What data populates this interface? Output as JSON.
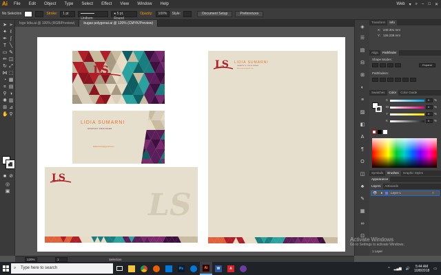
{
  "menubar": {
    "logo": "Ai",
    "items": [
      "File",
      "Edit",
      "Object",
      "Type",
      "Select",
      "Effect",
      "View",
      "Window",
      "Help"
    ],
    "workspace": "Web"
  },
  "control_bar": {
    "selection_label": "No Selection",
    "stroke_label": "Stroke:",
    "stroke_weight": "1 pt",
    "uniform_label": "Uniform",
    "brush_label": "5 pt. Round",
    "opacity_label": "Opacity:",
    "opacity_value": "100%",
    "style_label": "Style:",
    "doc_setup_label": "Document Setup",
    "preferences_label": "Preferences"
  },
  "tabs": [
    {
      "label": "logo lidia.ai @ 100% (RGB/Preview)",
      "active": false
    },
    {
      "label": "bugas polygonai.ai @ 120% (CMYK/Preview)",
      "active": true
    }
  ],
  "business_card": {
    "name": "LIDIA SUMARNI",
    "title": "GRAPHIC DESIGNER",
    "email": "lidiasumarni@gmail.com",
    "logo": "LS"
  },
  "letterhead": {
    "name": "LIDIA SUMARNI",
    "title": "GRAPHIC DESIGNER",
    "email": "lidiasumarni@gmail.com",
    "logo": "LS"
  },
  "envelope": {
    "logo": "LS",
    "watermark_logo": "LS"
  },
  "statusbar": {
    "zoom": "120%",
    "page": "1",
    "tool": "Selection"
  },
  "panels": {
    "transform_tab": "Transform",
    "info_tab": "Info",
    "x_label": "X:",
    "x_value": "240.301 mm",
    "y_label": "Y:",
    "y_value": "126.239 mm",
    "align_tab": "Align",
    "pathfinder_tab": "Pathfinder",
    "shape_modes": "Shape Modes:",
    "expand": "Expand",
    "pathfinders": "Pathfinders:",
    "swatches_tab": "Swatches",
    "color_tab": "Color",
    "color_guide_tab": "Color Guide",
    "channels": [
      {
        "label": "C",
        "value": "0",
        "unit": "%",
        "color": "#00a0e6"
      },
      {
        "label": "M",
        "value": "0",
        "unit": "%",
        "color": "#e6007e"
      },
      {
        "label": "Y",
        "value": "0",
        "unit": "%",
        "color": "#ffe600"
      },
      {
        "label": "K",
        "value": "0",
        "unit": "%",
        "color": "#222222"
      }
    ],
    "symbols_tab": "Symbols",
    "brushes_tab": "Brushes",
    "graphic_styles_tab": "Graphic Styles",
    "appearance_tab": "Appearance",
    "layers_tab": "Layers",
    "artboards_tab": "Artboards",
    "layer_name": "Layer 1",
    "layer_count": "1 Layer"
  },
  "windows_watermark": {
    "line1": "Activate Windows",
    "line2": "Go to Settings to activate Windows."
  },
  "taskbar": {
    "search_placeholder": "Type here to search",
    "time": "5:44 AM",
    "date": "10/8/2018",
    "apps": [
      "explorer",
      "chrome",
      "firefox",
      "store",
      "photoshop",
      "edge",
      "illustrator",
      "word",
      "acrobat",
      "media"
    ]
  },
  "colors": {
    "accent_orange": "#ff9a00",
    "logo_red": "#b01e28",
    "name_orange": "#e8742a",
    "cream": "#e6dfcd",
    "teal": "#1a7d80",
    "purple": "#5a1e5a"
  }
}
